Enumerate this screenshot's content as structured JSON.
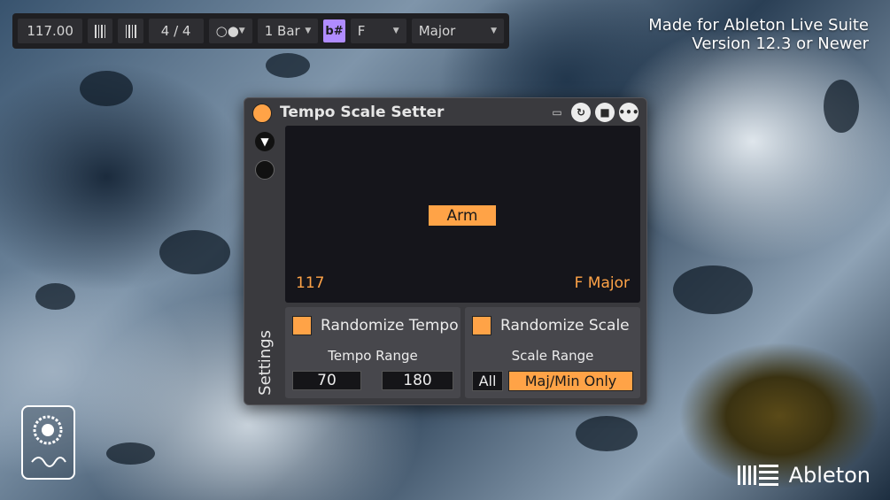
{
  "transport": {
    "tempo": "117.00",
    "time_signature": "4 / 4",
    "metronome": "○●",
    "quantize": "1 Bar",
    "key_toggle": "b#",
    "root": "F",
    "scale": "Major"
  },
  "branding": {
    "line1": "Made for Ableton Live Suite",
    "line2": "Version 12.3 or Newer"
  },
  "device": {
    "title": "Tempo Scale Setter",
    "side_label": "Settings",
    "arm_label": "Arm",
    "tempo_readout": "117",
    "scale_readout": "F Major",
    "tempo_panel": {
      "checkbox_label": "Randomize Tempo",
      "range_label": "Tempo Range",
      "min": "70",
      "max": "180"
    },
    "scale_panel": {
      "checkbox_label": "Randomize Scale",
      "range_label": "Scale Range",
      "opt_all": "All",
      "opt_majmin": "Maj/Min Only"
    }
  },
  "footer": {
    "brand": "Ableton",
    "logo_text": "Ableton"
  },
  "colors": {
    "accent": "#ffa347",
    "display_bg": "#15151b",
    "device_bg": "#3a3a3e"
  }
}
